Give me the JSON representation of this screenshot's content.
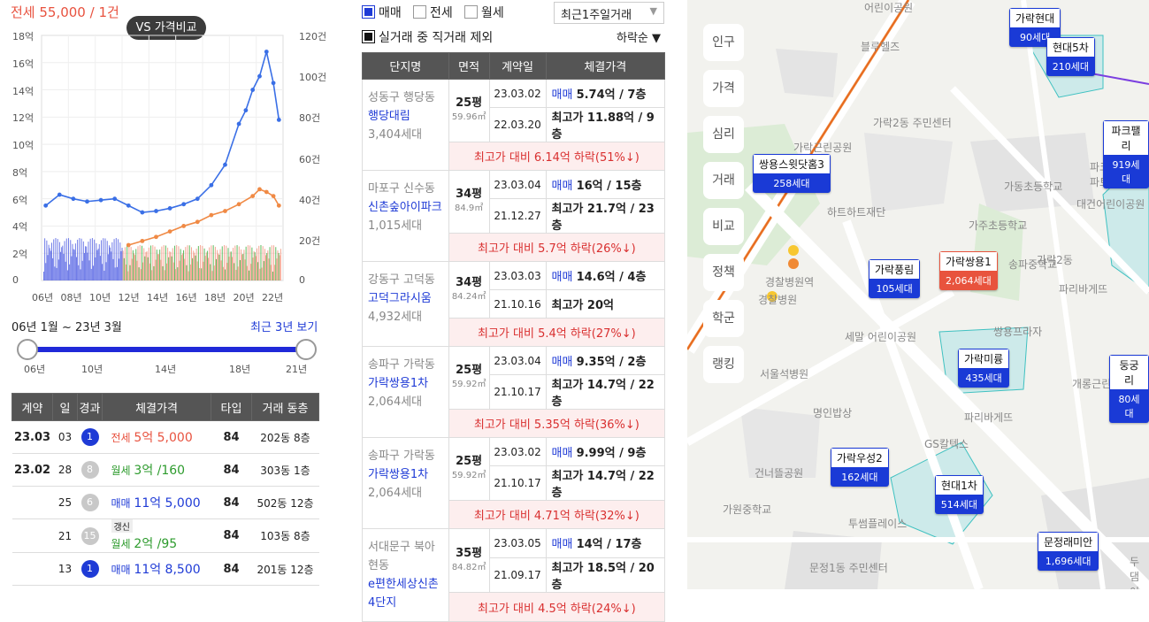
{
  "summary": {
    "title": "전세 55,000 / 1건",
    "vs_button": "VS 가격비교"
  },
  "chart_data": {
    "type": "line",
    "x_tick_labels": [
      "06년",
      "08년",
      "10년",
      "12년",
      "14년",
      "16년",
      "18년",
      "20년",
      "22년"
    ],
    "y_left_ticks": [
      "18억",
      "16억",
      "14억",
      "12억",
      "10억",
      "8억",
      "6억",
      "4억",
      "2억",
      "0"
    ],
    "y_right_ticks": [
      "120건",
      "100건",
      "80건",
      "60건",
      "40건",
      "20건",
      "0"
    ],
    "ylim_left": [
      0,
      18
    ],
    "ylim_right": [
      0,
      120
    ],
    "series": [
      {
        "color": "#3a6fe6",
        "x": [
          2006,
          2007,
          2008,
          2009,
          2010,
          2011,
          2012,
          2013,
          2014,
          2015,
          2016,
          2017,
          2018,
          2019,
          2020,
          2020.5,
          2021,
          2021.5,
          2022,
          2022.5,
          2022.9
        ],
        "values": [
          5.5,
          6.3,
          6,
          5.8,
          5.9,
          6,
          5.5,
          5,
          5.1,
          5.3,
          5.6,
          6,
          7,
          8.5,
          11.5,
          12.5,
          14,
          15,
          16.8,
          14.5,
          11.8
        ]
      },
      {
        "color": "#f08a45",
        "x": [
          2012,
          2013,
          2014,
          2015,
          2016,
          2017,
          2018,
          2019,
          2020,
          2021,
          2021.5,
          2022,
          2022.5,
          2022.9
        ],
        "values": [
          2.6,
          2.9,
          3.2,
          3.6,
          4,
          4.3,
          4.8,
          5.1,
          5.6,
          6.2,
          6.7,
          6.5,
          6.2,
          5.5
        ]
      }
    ],
    "volume_colors": [
      "#4050e0",
      "#f08a70",
      "#2aa62a"
    ]
  },
  "period": {
    "range": "06년 1월 ~ 23년 3월",
    "recent": "최근 3년 보기",
    "slider_ticks": [
      "06년",
      "10년",
      "14년",
      "18년",
      "21년"
    ]
  },
  "deals": {
    "headers": [
      "계약",
      "일",
      "경과",
      "체결가격",
      "타입",
      "거래 동층"
    ],
    "rows": [
      {
        "month": "23.03",
        "day": "03",
        "count": "1",
        "count_color": "#1f3bd6",
        "kind": "전세",
        "kind_color": "#e8523f",
        "price": "5억 5,000",
        "type": "84",
        "dong": "202동",
        "floor": "8층"
      },
      {
        "month": "23.02",
        "day": "28",
        "count": "8",
        "count_color": "#c8c8c8",
        "kind": "월세",
        "kind_color": "#2d9b2d",
        "price": "3억 /160",
        "type": "84",
        "dong": "303동",
        "floor": "1층"
      },
      {
        "month": "",
        "day": "25",
        "count": "6",
        "count_color": "#c8c8c8",
        "kind": "매매",
        "kind_color": "#1f3bd6",
        "price": "11억 5,000",
        "type": "84",
        "dong": "502동",
        "floor": "12층"
      },
      {
        "month": "",
        "day": "21",
        "count": "15",
        "count_color": "#c8c8c8",
        "renew": "갱신",
        "kind": "월세",
        "kind_color": "#2d9b2d",
        "price": "2억 /95",
        "type": "84",
        "dong": "103동",
        "floor": "8층"
      },
      {
        "month": "",
        "day": "13",
        "count": "1",
        "count_color": "#1f3bd6",
        "kind": "매매",
        "kind_color": "#1f3bd6",
        "price": "11억 8,500",
        "type": "84",
        "dong": "201동",
        "floor": "12층"
      }
    ]
  },
  "filters": {
    "trade": "매매",
    "jeonse": "전세",
    "wolse": "월세",
    "period_select": "최근1주일거래",
    "exclude_direct": "실거래 중 직거래 제외",
    "sort": "하락순"
  },
  "list": {
    "headers": [
      "단지명",
      "면적",
      "계약일",
      "체결가격"
    ],
    "items": [
      {
        "area": "성동구 행당동",
        "name": "행당대림",
        "households": "3,404세대",
        "pyeong": "25평",
        "sqm": "59.96㎡",
        "d1": "23.03.02",
        "p1k": "매매",
        "p1": "5.74억 / 7층",
        "d2": "22.03.20",
        "p2k": "최고가",
        "p2": "11.88억 / 9층",
        "drop": "최고가 대비 6.14억 하락(51%↓)"
      },
      {
        "area": "마포구 신수동",
        "name": "신촌숲아이파크",
        "households": "1,015세대",
        "pyeong": "34평",
        "sqm": "84.9㎡",
        "d1": "23.03.04",
        "p1k": "매매",
        "p1": "16억 / 15층",
        "d2": "21.12.27",
        "p2k": "최고가",
        "p2": "21.7억 / 23층",
        "drop": "최고가 대비 5.7억 하락(26%↓)"
      },
      {
        "area": "강동구 고덕동",
        "name": "고덕그라시움",
        "households": "4,932세대",
        "pyeong": "34평",
        "sqm": "84.24㎡",
        "d1": "23.03.03",
        "p1k": "매매",
        "p1": "14.6억 / 4층",
        "d2": "21.10.16",
        "p2k": "최고가",
        "p2": "20억",
        "drop": "최고가 대비 5.4억 하락(27%↓)"
      },
      {
        "area": "송파구 가락동",
        "name": "가락쌍용1차",
        "households": "2,064세대",
        "pyeong": "25평",
        "sqm": "59.92㎡",
        "d1": "23.03.04",
        "p1k": "매매",
        "p1": "9.35억 / 2층",
        "d2": "21.10.17",
        "p2k": "최고가",
        "p2": "14.7억 / 22층",
        "drop": "최고가 대비 5.35억 하락(36%↓)"
      },
      {
        "area": "송파구 가락동",
        "name": "가락쌍용1차",
        "households": "2,064세대",
        "pyeong": "25평",
        "sqm": "59.92㎡",
        "d1": "23.03.02",
        "p1k": "매매",
        "p1": "9.99억 / 9층",
        "d2": "21.10.17",
        "p2k": "최고가",
        "p2": "14.7억 / 22층",
        "drop": "최고가 대비 4.71억 하락(32%↓)"
      },
      {
        "area": "서대문구 북아현동",
        "name": "e편한세상신촌4단지",
        "households": "",
        "pyeong": "35평",
        "sqm": "84.82㎡",
        "d1": "23.03.05",
        "p1k": "매매",
        "p1": "14억 / 17층",
        "d2": "21.09.17",
        "p2k": "최고가",
        "p2": "18.5억 / 20층",
        "drop": "최고가 대비 4.5억 하락(24%↓)"
      }
    ]
  },
  "map": {
    "side_menu": [
      "인구",
      "가격",
      "심리",
      "거래",
      "비교",
      "정책",
      "학군",
      "랭킹"
    ],
    "pins": [
      {
        "name": "가락현대",
        "count": "90세대",
        "style": "blue"
      },
      {
        "name": "현대5차",
        "count": "210세대",
        "style": "blue"
      },
      {
        "name": "파크팰리",
        "count": "919세대",
        "style": "blue"
      },
      {
        "name": "쌍용스윗닷홈3",
        "count": "258세대",
        "style": "blue"
      },
      {
        "name": "가락풍림",
        "count": "105세대",
        "style": "blue"
      },
      {
        "name": "가락쌍용1",
        "count": "2,064세대",
        "style": "orange"
      },
      {
        "name": "가락미륭",
        "count": "435세대",
        "style": "blue"
      },
      {
        "name": "둥궁리",
        "count": "80세대",
        "style": "blue"
      },
      {
        "name": "가락우성2",
        "count": "162세대",
        "style": "blue"
      },
      {
        "name": "현대1차",
        "count": "514세대",
        "style": "blue"
      },
      {
        "name": "문정래미안",
        "count": "1,696세대",
        "style": "blue"
      }
    ],
    "labels": [
      "어린이공원",
      "블루헬즈",
      "가락2동 주민센터",
      "가락근린공원",
      "가동초등학교",
      "하트하트재단",
      "가주초등학교",
      "가락2동",
      "송파중학교",
      "파리바게뜨",
      "경찰병원역",
      "경찰병원",
      "세말 어린이공원",
      "쌍용프라자",
      "서울석병원",
      "명인밥상",
      "파리바게뜨",
      "GS칼텍스",
      "개롱근린공원",
      "건너뜰공원",
      "가원중학교",
      "투썸플레이스",
      "문정1동 주민센터",
      "대건어린이공원",
      "파크펠리스아파트",
      "두댐이공원"
    ]
  }
}
